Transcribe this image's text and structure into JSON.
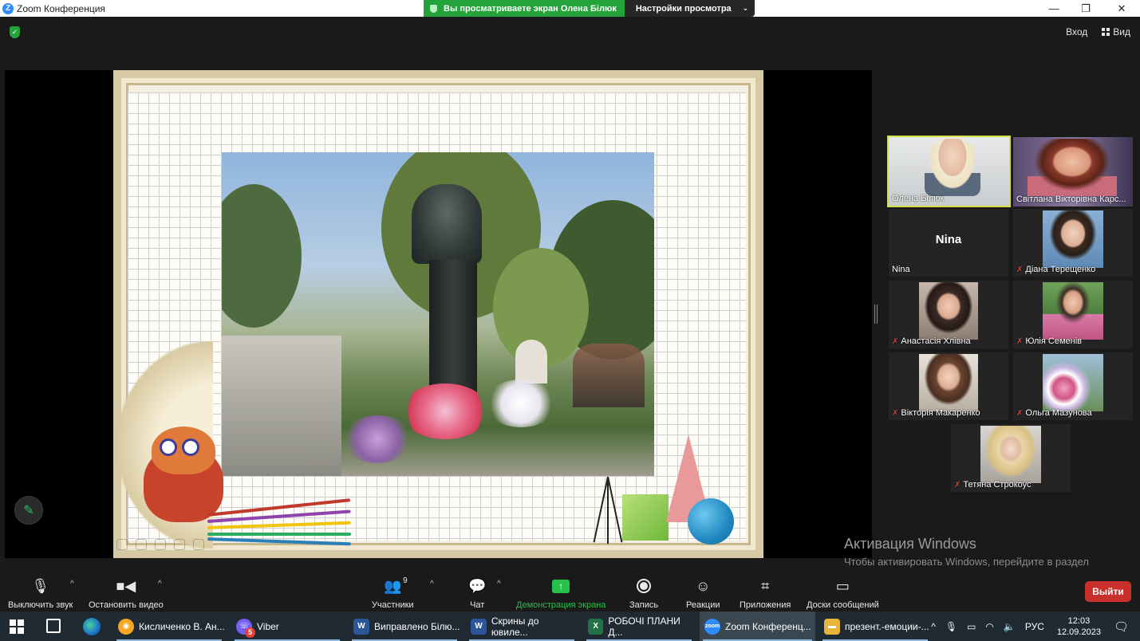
{
  "window": {
    "title": "Zoom Конференция",
    "minimize": "—",
    "maximize": "❐",
    "close": "✕"
  },
  "share_banner": {
    "viewing": "Вы просматриваете экран Олена Білюк",
    "view_settings": "Настройки просмотра"
  },
  "topbar": {
    "enter": "Вход",
    "view": "Вид"
  },
  "participants": [
    {
      "name": "Олена Білюк",
      "muted": false,
      "active": true
    },
    {
      "name": "Світлана Вікторівна Карс...",
      "muted": false,
      "active": false
    },
    {
      "name": "Nina",
      "display": "Nina",
      "muted": false,
      "active": false
    },
    {
      "name": "Діана Терещенко",
      "muted": true,
      "active": false
    },
    {
      "name": "Анастасія Хлівна",
      "muted": true,
      "active": false
    },
    {
      "name": "Юлія Семенів",
      "muted": true,
      "active": false
    },
    {
      "name": "Вікторія Макаренко",
      "muted": true,
      "active": false
    },
    {
      "name": "Ольга Мазунова",
      "muted": true,
      "active": false
    },
    {
      "name": "Тетяна Строкоус",
      "muted": true,
      "active": false
    }
  ],
  "watermark": {
    "title": "Активация Windows",
    "subtitle": "Чтобы активировать Windows, перейдите в раздел \"Параметры\"."
  },
  "toolbar": {
    "mute": "Выключить звук",
    "stop_video": "Остановить видео",
    "participants": "Участники",
    "participants_count": "9",
    "chat": "Чат",
    "share": "Демонстрация экрана",
    "record": "Запись",
    "reactions": "Реакции",
    "apps": "Приложения",
    "whiteboards": "Доски сообщений",
    "leave": "Выйти"
  },
  "taskbar": {
    "apps": [
      {
        "label": "Кисличенко В. Ан...",
        "icon": "browser-icon",
        "color": "#f5a623"
      },
      {
        "label": "Viber",
        "icon": "viber-icon",
        "color": "#7360f2",
        "badge": "5"
      },
      {
        "label": "Виправлено Білю...",
        "icon": "word-icon",
        "color": "#2b579a"
      },
      {
        "label": "Скрины до ювиле...",
        "icon": "word-icon",
        "color": "#2b579a"
      },
      {
        "label": "РОБОЧІ ПЛАНИ Д...",
        "icon": "excel-icon",
        "color": "#217346"
      },
      {
        "label": "Zoom Конференц...",
        "icon": "zoom-icon",
        "color": "#2d8cff"
      },
      {
        "label": "презент.-емоции-...",
        "icon": "folder-icon",
        "color": "#e8b43a"
      }
    ],
    "language": "РУС",
    "time": "12:03",
    "date": "12.09.2023"
  },
  "colors": {
    "accent_green": "#27c24c",
    "leave_red": "#c9302c",
    "active_speaker": "#d6e04a"
  }
}
